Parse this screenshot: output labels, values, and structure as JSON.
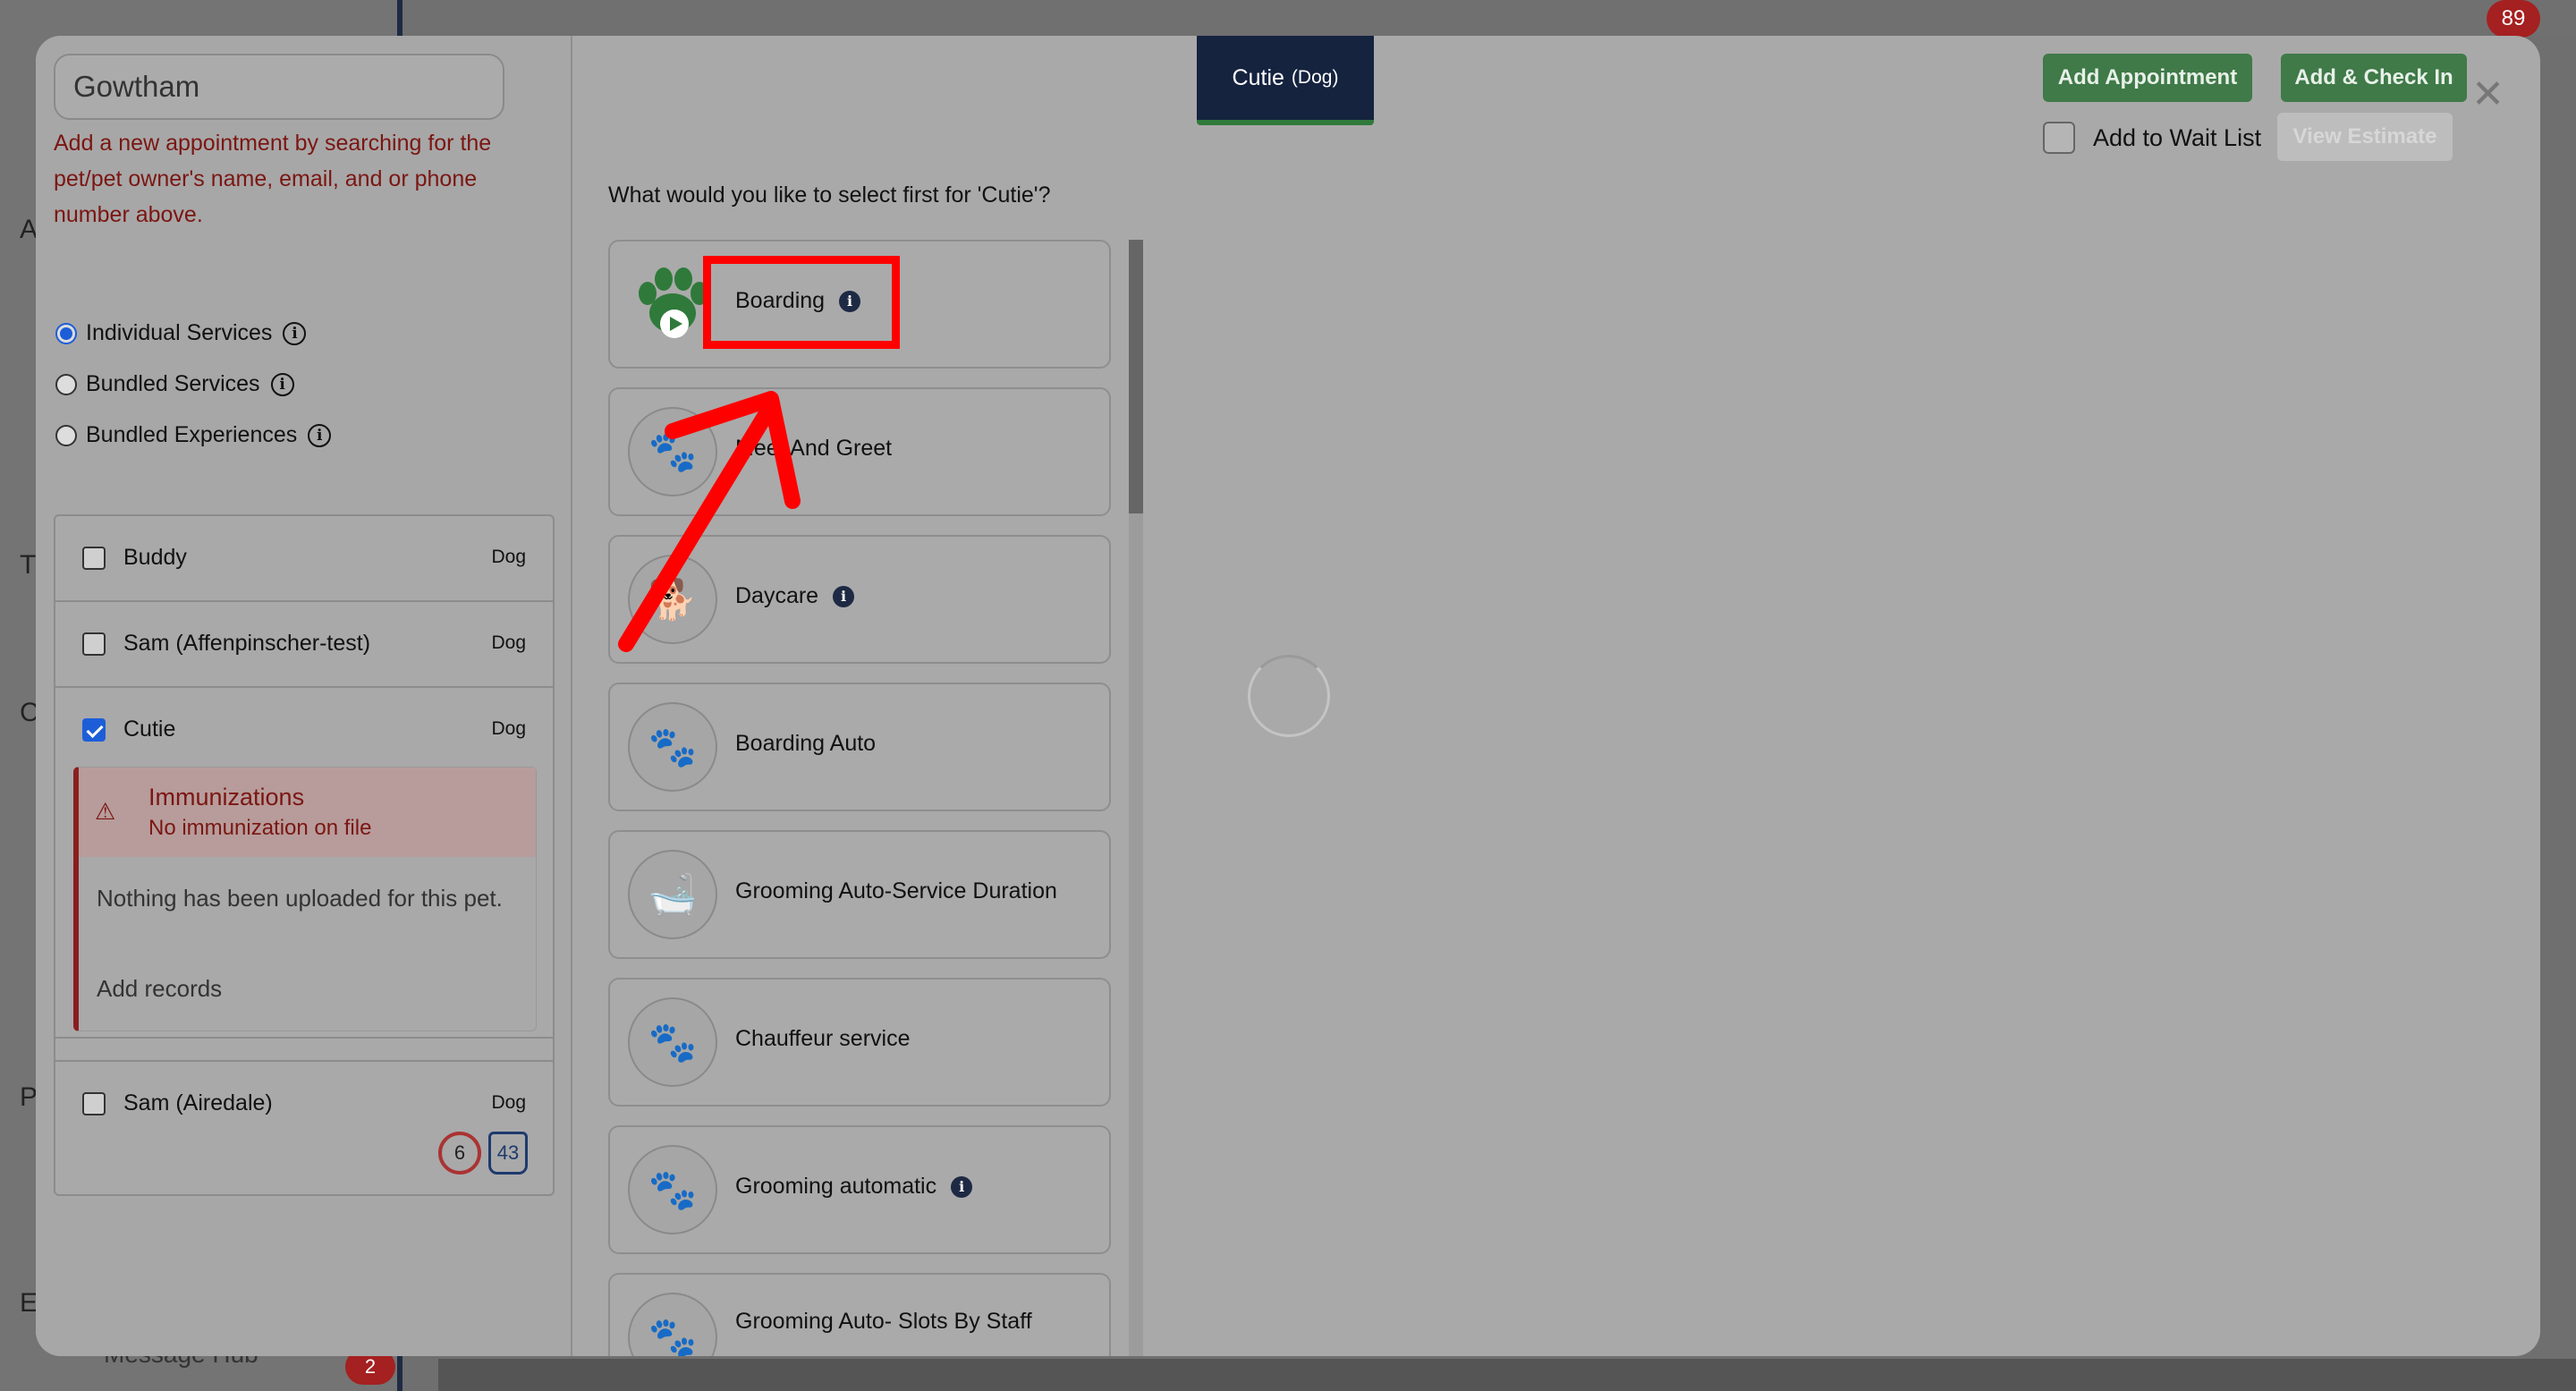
{
  "background": {
    "notifications_count": "89",
    "side_letters": [
      "A",
      "T",
      "C",
      "P",
      "E"
    ],
    "message_hub_label": "Message Hub",
    "message_hub_count": "2"
  },
  "left_panel": {
    "search_value": "Gowtham",
    "hint": "Add a new appointment by searching for the pet/pet owner's name, email, and or phone number above.",
    "service_types": [
      {
        "label": "Individual Services",
        "selected": true
      },
      {
        "label": "Bundled Services",
        "selected": false
      },
      {
        "label": "Bundled Experiences",
        "selected": false
      }
    ],
    "pets": [
      {
        "name": "Buddy",
        "species": "Dog",
        "checked": false
      },
      {
        "name": "Sam (Affenpinscher-test)",
        "species": "Dog",
        "checked": false
      },
      {
        "name": "Cutie",
        "species": "Dog",
        "checked": true
      },
      {
        "name": "Sam (Airedale)",
        "species": "Dog",
        "checked": false
      }
    ],
    "immunization": {
      "title": "Immunizations",
      "subtitle": "No immunization on file",
      "body": "Nothing has been uploaded for this pet.",
      "link": "Add records"
    },
    "history_count": "6",
    "weight_value": "43"
  },
  "main": {
    "pet_tab": {
      "name": "Cutie",
      "species": "(Dog)"
    },
    "add_appointment_label": "Add Appointment",
    "add_checkin_label": "Add & Check In",
    "wait_list_label": "Add to Wait List",
    "view_estimate_label": "View Estimate",
    "close_symbol": "✕",
    "question": "What would you like to select first for 'Cutie'?",
    "services": [
      {
        "label": "Boarding",
        "info": true,
        "icon": "paw-play-icon"
      },
      {
        "label": "Meet And Greet",
        "info": false,
        "icon": "paw-icon"
      },
      {
        "label": "Daycare",
        "info": true,
        "icon": "daycare-icon"
      },
      {
        "label": "Boarding Auto",
        "info": false,
        "icon": "paw-icon"
      },
      {
        "label": "Grooming Auto-Service Duration",
        "info": false,
        "icon": "grooming-icon"
      },
      {
        "label": "Chauffeur service",
        "info": false,
        "icon": "paw-icon"
      },
      {
        "label": "Grooming automatic",
        "info": true,
        "icon": "paw-icon"
      },
      {
        "label": "Grooming Auto- Slots By Staff",
        "info": false,
        "icon": "paw-icon"
      }
    ]
  },
  "colors": {
    "accent_green": "#3f7a48",
    "tab_navy": "#15233f",
    "alert_red": "#7b1612",
    "annotation_red": "#ff0000"
  }
}
